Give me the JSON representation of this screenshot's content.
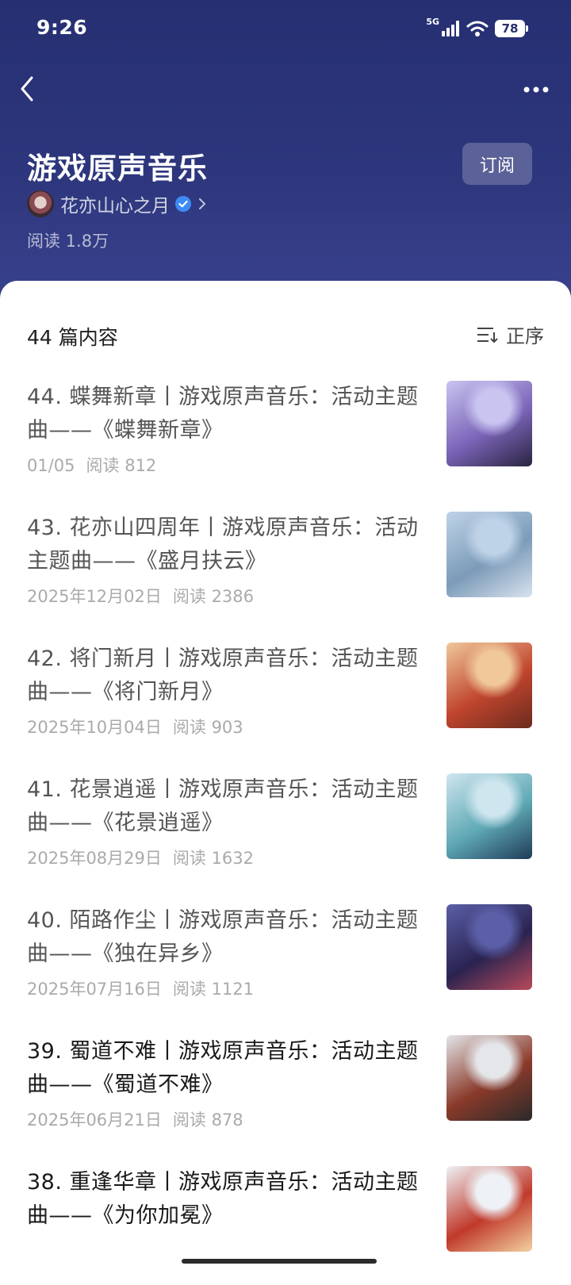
{
  "status_bar": {
    "time": "9:26",
    "network": "5G",
    "battery": "78"
  },
  "header": {
    "title": "游戏原声音乐",
    "subscribe_label": "订阅",
    "author": "花亦山心之月",
    "reads": "阅读 1.8万"
  },
  "list_header": {
    "count_label": "44 篇内容",
    "sort_label": "正序"
  },
  "articles": [
    {
      "title": "44. 蝶舞新章丨游戏原声音乐：活动主题曲——《蝶舞新章》",
      "date": "01/05",
      "reads": "阅读 812",
      "thumb_colors": [
        "#c9c4f0",
        "#7a64b8",
        "#2a2440"
      ]
    },
    {
      "title": "43. 花亦山四周年丨游戏原声音乐：活动主题曲——《盛月扶云》",
      "date": "2025年12月02日",
      "reads": "阅读 2386",
      "thumb_colors": [
        "#bfd3e8",
        "#7b9bb8",
        "#d9e2ef"
      ]
    },
    {
      "title": "42. 将门新月丨游戏原声音乐：活动主题曲——《将门新月》",
      "date": "2025年10月04日",
      "reads": "阅读 903",
      "thumb_colors": [
        "#f0c89a",
        "#c0452e",
        "#6b2a1e"
      ]
    },
    {
      "title": "41. 花景逍遥丨游戏原声音乐：活动主题曲——《花景逍遥》",
      "date": "2025年08月29日",
      "reads": "阅读 1632",
      "thumb_colors": [
        "#cfe6ef",
        "#5fa9b5",
        "#1f3b56"
      ]
    },
    {
      "title": "40. 陌路作尘丨游戏原声音乐：活动主题曲——《独在异乡》",
      "date": "2025年07月16日",
      "reads": "阅读 1121",
      "thumb_colors": [
        "#5a5fa8",
        "#2a2350",
        "#b84a5a"
      ]
    },
    {
      "title": "39. 蜀道不难丨游戏原声音乐：活动主题曲——《蜀道不难》",
      "date": "2025年06月21日",
      "reads": "阅读 878",
      "thumb_colors": [
        "#e4e6ea",
        "#8a3a2a",
        "#2a2a2a"
      ]
    },
    {
      "title": "38. 重逢华章丨游戏原声音乐：活动主题曲——《为你加冕》",
      "date": "",
      "reads": "",
      "thumb_colors": [
        "#eef2f6",
        "#c0392b",
        "#f2d2a0"
      ]
    }
  ]
}
